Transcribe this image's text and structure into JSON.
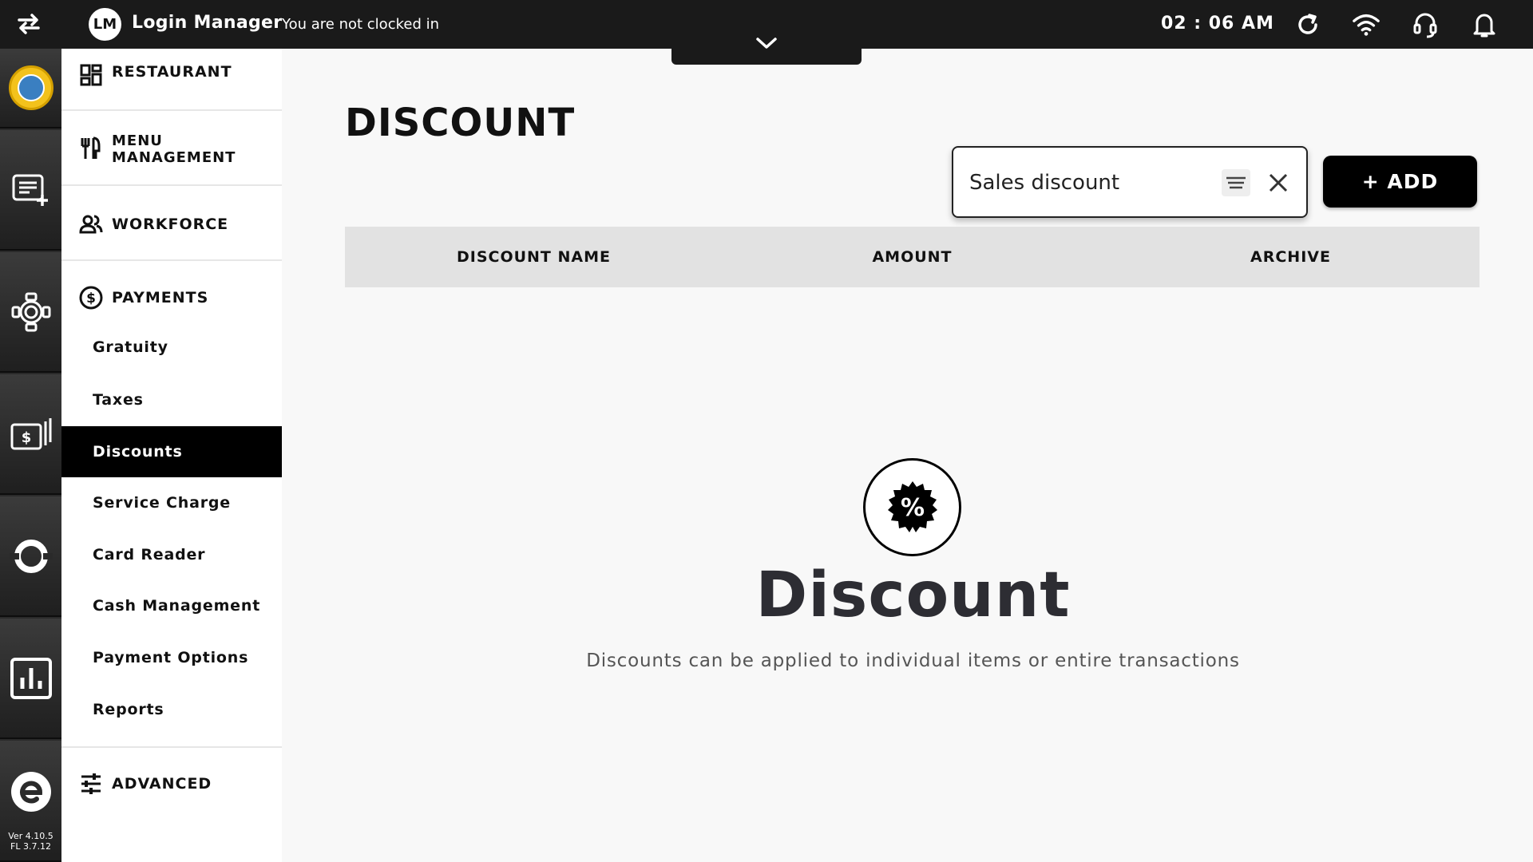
{
  "topbar": {
    "avatar_initials": "LM",
    "user_name": "Login Manager",
    "clock_status": "You are not clocked in",
    "time": "02 : 06 AM",
    "icons": [
      "swap-arrows-icon",
      "refresh-icon",
      "wifi-icon",
      "headset-icon",
      "bell-icon",
      "chevron-down-icon"
    ]
  },
  "rail": {
    "items": [
      "restaurant-logo",
      "new-order-icon",
      "table-service-icon",
      "cash-register-icon",
      "cycle-icon",
      "reports-chart-icon",
      "app-logo-icon"
    ],
    "version_line1": "Ver 4.10.5",
    "version_line2": "FL 3.7.12"
  },
  "sidebar": {
    "restaurant": "RESTAURANT",
    "menu_management_line1": "MENU",
    "menu_management_line2": "MANAGEMENT",
    "workforce": "WORKFORCE",
    "payments": "PAYMENTS",
    "payment_items": [
      "Gratuity",
      "Taxes",
      "Discounts",
      "Service Charge",
      "Card Reader",
      "Cash Management",
      "Payment Options",
      "Reports"
    ],
    "active_item": "Discounts",
    "advanced": "ADVANCED"
  },
  "main": {
    "title": "DISCOUNT",
    "search_value": "Sales discount",
    "add_label": "+ ADD",
    "columns": [
      "DISCOUNT NAME",
      "AMOUNT",
      "ARCHIVE"
    ],
    "empty_title": "Discount",
    "empty_subtitle": "Discounts can be applied to individual items or entire transactions",
    "empty_icon_glyph": "%"
  },
  "colors": {
    "topbar": "#1a1a1a",
    "active": "#000000",
    "table_header": "#e2e2e2",
    "search_caret": "#1a73e8"
  }
}
